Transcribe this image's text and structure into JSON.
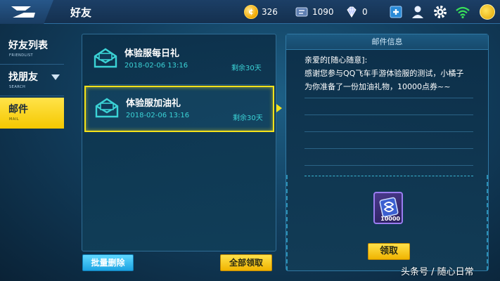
{
  "header": {
    "title": "好友",
    "coins": "326",
    "tickets": "1090",
    "diamonds": "0",
    "icons": [
      "back-logo-icon",
      "coin-icon",
      "ticket-icon",
      "diamond-icon",
      "add-icon",
      "profile-icon",
      "gear-icon",
      "wifi-icon",
      "avatar"
    ]
  },
  "sidebar": {
    "items": [
      {
        "label": "好友列表",
        "sub": "FRIENDLIST",
        "active": false
      },
      {
        "label": "找朋友",
        "sub": "SEARCH",
        "active": false
      },
      {
        "label": "邮件",
        "sub": "MAIL",
        "active": true
      }
    ]
  },
  "mail_list": {
    "items": [
      {
        "title": "体验服每日礼",
        "date": "2018-02-06 13:16",
        "remain": "剩余30天",
        "selected": false
      },
      {
        "title": "体验服加油礼",
        "date": "2018-02-06 13:16",
        "remain": "剩余30天",
        "selected": true
      }
    ]
  },
  "detail": {
    "header": "邮件信息",
    "lines": [
      "亲爱的[随心随意]:",
      "感谢您参与QQ飞车手游体验服的测试，小橘子",
      "为你准备了一份加油礼物，10000点券~~"
    ],
    "reward_count": "10000",
    "claim_label": "领取"
  },
  "footer": {
    "batch_delete_label": "批量删除",
    "claim_all_label": "全部领取"
  },
  "watermark": "头条号 / 随心日常",
  "colors": {
    "accent_yellow": "#f5e21a",
    "accent_cyan": "#3bd3d6",
    "button_blue": "#1ca3e2"
  }
}
